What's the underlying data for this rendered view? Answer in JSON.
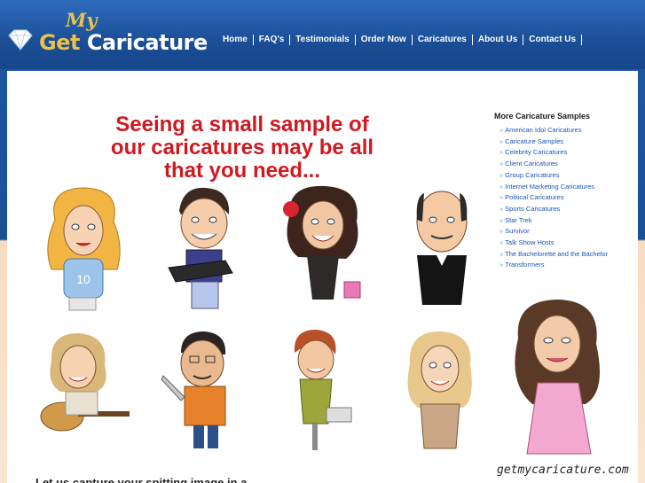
{
  "brand": {
    "my": "My",
    "get": "Get",
    "name": "Caricature"
  },
  "nav": [
    "Home",
    "FAQ's",
    "Testimonials",
    "Order Now",
    "Caricatures",
    "About Us",
    "Contact Us"
  ],
  "headline": "Seeing a small sample of our caricatures may be all that you need...",
  "sidebar": {
    "title": "More Caricature Samples",
    "items": [
      "American Idol Caricatures",
      "Caricature Samples",
      "Celebrity Caricatures",
      "Client Caricatures",
      "Group Caricatures",
      "Internet Marketing Caricatures",
      "Political Caricatures",
      "Sports Caricatures",
      "Star Trek",
      "Survivor",
      "Talk Show Hosts",
      "The Bachelorette and the Bachelor",
      "Transformers"
    ]
  },
  "watermark": "getmycaricature.com",
  "tagline": "Let us capture your spitting image in a",
  "colors": {
    "header": "#1b4e97",
    "headline": "#d0191f",
    "link": "#1a55b4",
    "gold": "#e8c24a"
  }
}
